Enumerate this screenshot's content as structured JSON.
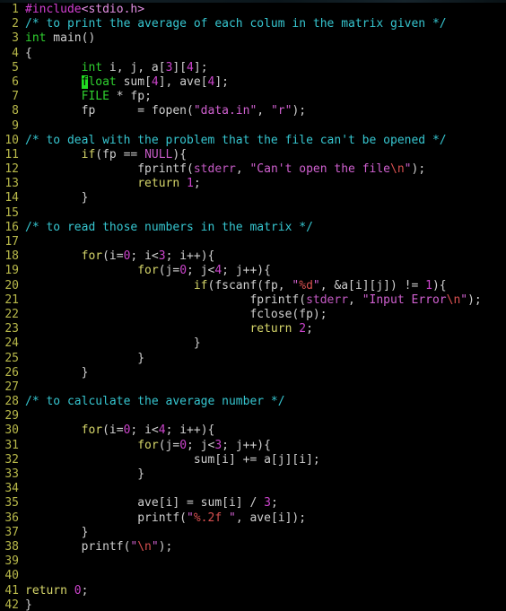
{
  "app": {
    "type": "terminal-code-editor",
    "language": "C",
    "theme": "dark",
    "background_color": "#000000",
    "gutter_color": "#b8b84a",
    "cursor_color": "#22dd22",
    "cursor_line": 6,
    "cursor_column": 9,
    "total_lines": 42
  },
  "colors": {
    "preprocessor": "#d33fd3",
    "include_path": "#e38fe3",
    "comment": "#36c6d0",
    "keyword": "#2fd12f",
    "control": "#d6d66a",
    "number": "#cc44cc",
    "string": "#d060d0",
    "escape": "#d85050",
    "constant": "#c45ac4",
    "plain": "#cfcfcf"
  },
  "lines": [
    {
      "n": "1",
      "tokens": [
        {
          "t": "#include",
          "c": "tok-pre"
        },
        {
          "t": "<stdio.h>",
          "c": "tok-inc"
        }
      ]
    },
    {
      "n": "2",
      "tokens": [
        {
          "t": "/* to print the average of each colum in the matrix given */",
          "c": "tok-comment"
        }
      ]
    },
    {
      "n": "3",
      "tokens": [
        {
          "t": "int",
          "c": "tok-kw"
        },
        {
          "t": " main()",
          "c": "tok-plain"
        }
      ]
    },
    {
      "n": "4",
      "tokens": [
        {
          "t": "{",
          "c": "tok-plain"
        }
      ]
    },
    {
      "n": "5",
      "tokens": [
        {
          "t": "        ",
          "c": "tok-plain"
        },
        {
          "t": "int",
          "c": "tok-kw"
        },
        {
          "t": " i, j, a[",
          "c": "tok-plain"
        },
        {
          "t": "3",
          "c": "tok-num"
        },
        {
          "t": "][",
          "c": "tok-plain"
        },
        {
          "t": "4",
          "c": "tok-num"
        },
        {
          "t": "];",
          "c": "tok-plain"
        }
      ]
    },
    {
      "n": "6",
      "tokens": [
        {
          "t": "        ",
          "c": "tok-plain"
        },
        {
          "t": "f",
          "c": "cursor"
        },
        {
          "t": "loat",
          "c": "tok-kw"
        },
        {
          "t": " sum[",
          "c": "tok-plain"
        },
        {
          "t": "4",
          "c": "tok-num"
        },
        {
          "t": "], ave[",
          "c": "tok-plain"
        },
        {
          "t": "4",
          "c": "tok-num"
        },
        {
          "t": "];",
          "c": "tok-plain"
        }
      ]
    },
    {
      "n": "7",
      "tokens": [
        {
          "t": "        ",
          "c": "tok-plain"
        },
        {
          "t": "FILE",
          "c": "tok-kw"
        },
        {
          "t": " * fp;",
          "c": "tok-plain"
        }
      ]
    },
    {
      "n": "8",
      "tokens": [
        {
          "t": "        fp      = fopen(",
          "c": "tok-plain"
        },
        {
          "t": "\"data.in\"",
          "c": "tok-str"
        },
        {
          "t": ", ",
          "c": "tok-plain"
        },
        {
          "t": "\"r\"",
          "c": "tok-str"
        },
        {
          "t": ");",
          "c": "tok-plain"
        }
      ]
    },
    {
      "n": "9",
      "tokens": []
    },
    {
      "n": "10",
      "tokens": [
        {
          "t": "/* to deal with the problem that the file can't be opened */",
          "c": "tok-comment"
        }
      ]
    },
    {
      "n": "11",
      "tokens": [
        {
          "t": "        ",
          "c": "tok-plain"
        },
        {
          "t": "if",
          "c": "tok-ctrl"
        },
        {
          "t": "(fp == ",
          "c": "tok-plain"
        },
        {
          "t": "NULL",
          "c": "tok-const"
        },
        {
          "t": "){",
          "c": "tok-plain"
        }
      ]
    },
    {
      "n": "12",
      "tokens": [
        {
          "t": "                fprintf(",
          "c": "tok-plain"
        },
        {
          "t": "stderr",
          "c": "tok-const"
        },
        {
          "t": ", ",
          "c": "tok-plain"
        },
        {
          "t": "\"Can't open the file",
          "c": "tok-str"
        },
        {
          "t": "\\n",
          "c": "tok-esc"
        },
        {
          "t": "\"",
          "c": "tok-str"
        },
        {
          "t": ");",
          "c": "tok-plain"
        }
      ]
    },
    {
      "n": "13",
      "tokens": [
        {
          "t": "                ",
          "c": "tok-plain"
        },
        {
          "t": "return",
          "c": "tok-ctrl"
        },
        {
          "t": " ",
          "c": "tok-plain"
        },
        {
          "t": "1",
          "c": "tok-num"
        },
        {
          "t": ";",
          "c": "tok-plain"
        }
      ]
    },
    {
      "n": "14",
      "tokens": [
        {
          "t": "        }",
          "c": "tok-plain"
        }
      ]
    },
    {
      "n": "15",
      "tokens": []
    },
    {
      "n": "16",
      "tokens": [
        {
          "t": "/* to read those numbers in the matrix */",
          "c": "tok-comment"
        }
      ]
    },
    {
      "n": "17",
      "tokens": []
    },
    {
      "n": "18",
      "tokens": [
        {
          "t": "        ",
          "c": "tok-plain"
        },
        {
          "t": "for",
          "c": "tok-ctrl"
        },
        {
          "t": "(i=",
          "c": "tok-plain"
        },
        {
          "t": "0",
          "c": "tok-num"
        },
        {
          "t": "; i<",
          "c": "tok-plain"
        },
        {
          "t": "3",
          "c": "tok-num"
        },
        {
          "t": "; i++){",
          "c": "tok-plain"
        }
      ]
    },
    {
      "n": "19",
      "tokens": [
        {
          "t": "                ",
          "c": "tok-plain"
        },
        {
          "t": "for",
          "c": "tok-ctrl"
        },
        {
          "t": "(j=",
          "c": "tok-plain"
        },
        {
          "t": "0",
          "c": "tok-num"
        },
        {
          "t": "; j<",
          "c": "tok-plain"
        },
        {
          "t": "4",
          "c": "tok-num"
        },
        {
          "t": "; j++){",
          "c": "tok-plain"
        }
      ]
    },
    {
      "n": "20",
      "tokens": [
        {
          "t": "                        ",
          "c": "tok-plain"
        },
        {
          "t": "if",
          "c": "tok-ctrl"
        },
        {
          "t": "(fscanf(fp, ",
          "c": "tok-plain"
        },
        {
          "t": "\"",
          "c": "tok-str"
        },
        {
          "t": "%d",
          "c": "tok-esc"
        },
        {
          "t": "\"",
          "c": "tok-str"
        },
        {
          "t": ", &a[i][j]) != ",
          "c": "tok-plain"
        },
        {
          "t": "1",
          "c": "tok-num"
        },
        {
          "t": "){",
          "c": "tok-plain"
        }
      ]
    },
    {
      "n": "21",
      "tokens": [
        {
          "t": "                                fprintf(",
          "c": "tok-plain"
        },
        {
          "t": "stderr",
          "c": "tok-const"
        },
        {
          "t": ", ",
          "c": "tok-plain"
        },
        {
          "t": "\"Input Error",
          "c": "tok-str"
        },
        {
          "t": "\\n",
          "c": "tok-esc"
        },
        {
          "t": "\"",
          "c": "tok-str"
        },
        {
          "t": ");",
          "c": "tok-plain"
        }
      ]
    },
    {
      "n": "22",
      "tokens": [
        {
          "t": "                                fclose(fp);",
          "c": "tok-plain"
        }
      ]
    },
    {
      "n": "23",
      "tokens": [
        {
          "t": "                                ",
          "c": "tok-plain"
        },
        {
          "t": "return",
          "c": "tok-ctrl"
        },
        {
          "t": " ",
          "c": "tok-plain"
        },
        {
          "t": "2",
          "c": "tok-num"
        },
        {
          "t": ";",
          "c": "tok-plain"
        }
      ]
    },
    {
      "n": "24",
      "tokens": [
        {
          "t": "                        }",
          "c": "tok-plain"
        }
      ]
    },
    {
      "n": "25",
      "tokens": [
        {
          "t": "                }",
          "c": "tok-plain"
        }
      ]
    },
    {
      "n": "26",
      "tokens": [
        {
          "t": "        }",
          "c": "tok-plain"
        }
      ]
    },
    {
      "n": "27",
      "tokens": []
    },
    {
      "n": "28",
      "tokens": [
        {
          "t": "/* to calculate the average number */",
          "c": "tok-comment"
        }
      ]
    },
    {
      "n": "29",
      "tokens": []
    },
    {
      "n": "30",
      "tokens": [
        {
          "t": "        ",
          "c": "tok-plain"
        },
        {
          "t": "for",
          "c": "tok-ctrl"
        },
        {
          "t": "(i=",
          "c": "tok-plain"
        },
        {
          "t": "0",
          "c": "tok-num"
        },
        {
          "t": "; i<",
          "c": "tok-plain"
        },
        {
          "t": "4",
          "c": "tok-num"
        },
        {
          "t": "; i++){",
          "c": "tok-plain"
        }
      ]
    },
    {
      "n": "31",
      "tokens": [
        {
          "t": "                ",
          "c": "tok-plain"
        },
        {
          "t": "for",
          "c": "tok-ctrl"
        },
        {
          "t": "(j=",
          "c": "tok-plain"
        },
        {
          "t": "0",
          "c": "tok-num"
        },
        {
          "t": "; j<",
          "c": "tok-plain"
        },
        {
          "t": "3",
          "c": "tok-num"
        },
        {
          "t": "; j++){",
          "c": "tok-plain"
        }
      ]
    },
    {
      "n": "32",
      "tokens": [
        {
          "t": "                        sum[i] += a[j][i];",
          "c": "tok-plain"
        }
      ]
    },
    {
      "n": "33",
      "tokens": [
        {
          "t": "                }",
          "c": "tok-plain"
        }
      ]
    },
    {
      "n": "34",
      "tokens": []
    },
    {
      "n": "35",
      "tokens": [
        {
          "t": "                ave[i] = sum[i] / ",
          "c": "tok-plain"
        },
        {
          "t": "3",
          "c": "tok-num"
        },
        {
          "t": ";",
          "c": "tok-plain"
        }
      ]
    },
    {
      "n": "36",
      "tokens": [
        {
          "t": "                printf(",
          "c": "tok-plain"
        },
        {
          "t": "\"",
          "c": "tok-str"
        },
        {
          "t": "%.2f",
          "c": "tok-esc"
        },
        {
          "t": " \"",
          "c": "tok-str"
        },
        {
          "t": ", ave[i]);",
          "c": "tok-plain"
        }
      ]
    },
    {
      "n": "37",
      "tokens": [
        {
          "t": "        }",
          "c": "tok-plain"
        }
      ]
    },
    {
      "n": "38",
      "tokens": [
        {
          "t": "        printf(",
          "c": "tok-plain"
        },
        {
          "t": "\"",
          "c": "tok-str"
        },
        {
          "t": "\\n",
          "c": "tok-esc"
        },
        {
          "t": "\"",
          "c": "tok-str"
        },
        {
          "t": ");",
          "c": "tok-plain"
        }
      ]
    },
    {
      "n": "39",
      "tokens": []
    },
    {
      "n": "40",
      "tokens": []
    },
    {
      "n": "41",
      "tokens": [
        {
          "t": "return",
          "c": "tok-ctrl"
        },
        {
          "t": " ",
          "c": "tok-plain"
        },
        {
          "t": "0",
          "c": "tok-num"
        },
        {
          "t": ";",
          "c": "tok-plain"
        }
      ]
    },
    {
      "n": "42",
      "tokens": [
        {
          "t": "}",
          "c": "tok-plain"
        }
      ]
    }
  ]
}
